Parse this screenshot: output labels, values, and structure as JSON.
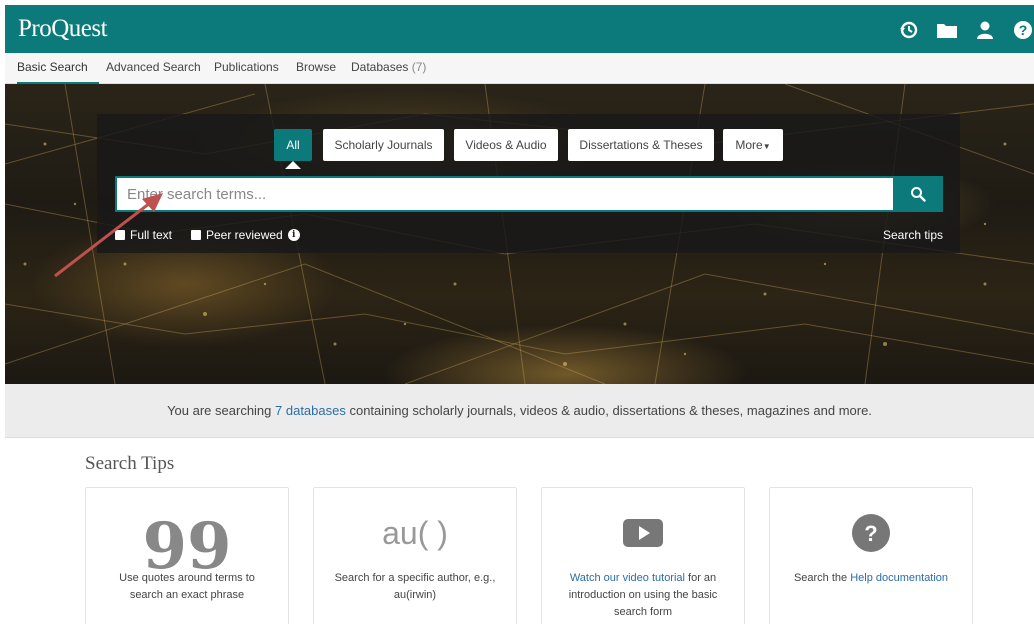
{
  "header": {
    "logo": "ProQuest",
    "icons": [
      "history-icon",
      "folder-icon",
      "user-icon",
      "help-icon"
    ]
  },
  "nav": {
    "items": [
      {
        "label": "Basic Search",
        "active": true
      },
      {
        "label": "Advanced Search"
      },
      {
        "label": "Publications"
      },
      {
        "label": "Browse"
      },
      {
        "label": "Databases"
      }
    ],
    "databases_count": "(7)"
  },
  "search": {
    "tabs": [
      "All",
      "Scholarly Journals",
      "Videos & Audio",
      "Dissertations & Theses",
      "More"
    ],
    "placeholder": "Enter search terms...",
    "full_text_label": "Full text",
    "peer_reviewed_label": "Peer reviewed",
    "search_tips_label": "Search tips"
  },
  "db_strip": {
    "prefix": "You are searching ",
    "link": "7 databases",
    "suffix": " containing scholarly journals, videos & audio, dissertations & theses, magazines and more."
  },
  "tips": {
    "heading": "Search Tips",
    "cards": [
      {
        "icon": "quote-icon",
        "symbol": "99",
        "text": "Use quotes around terms to search an exact phrase"
      },
      {
        "icon": "author-icon",
        "symbol": "au( )",
        "text": "Search for a specific author, e.g., au(irwin)"
      },
      {
        "icon": "video-play-icon",
        "link": "Watch our video tutorial",
        "text": " for an introduction on using the basic search form"
      },
      {
        "icon": "help-circle-icon",
        "prefix": "Search the ",
        "link": "Help documentation"
      }
    ]
  },
  "colors": {
    "brand": "#0c7a7a",
    "link": "#2b6da6",
    "arrow": "#c0504d"
  }
}
